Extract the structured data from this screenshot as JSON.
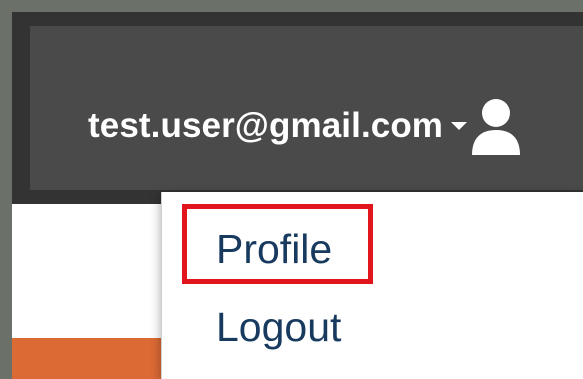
{
  "navbar": {
    "user_email": "test.user@gmail.com",
    "caret_icon": "caret-down-icon",
    "user_icon": "user-icon"
  },
  "dropdown": {
    "items": [
      {
        "label": "Profile",
        "highlighted": true
      },
      {
        "label": "Logout",
        "highlighted": false
      }
    ]
  },
  "colors": {
    "navbar_bg": "#4a4a4a",
    "text_white": "#ffffff",
    "menu_text": "#173a5e",
    "highlight": "#e1161c",
    "accent_orange": "#dc6a35"
  }
}
